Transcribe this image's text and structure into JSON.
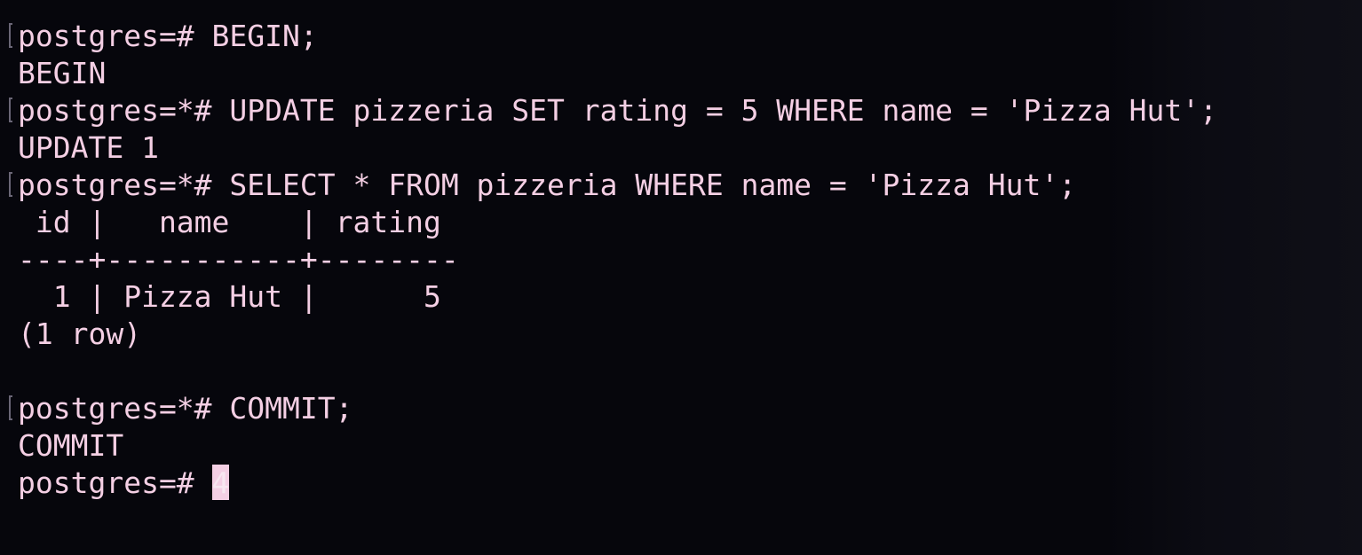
{
  "terminal": {
    "lines": [
      "postgres=# BEGIN;",
      "BEGIN",
      "postgres=*# UPDATE pizzeria SET rating = 5 WHERE name = 'Pizza Hut';",
      "UPDATE 1",
      "postgres=*# SELECT * FROM pizzeria WHERE name = 'Pizza Hut';",
      " id |   name    | rating",
      "----+-----------+--------",
      "  1 | Pizza Hut |      5",
      "(1 row)",
      "",
      "postgres=*# COMMIT;",
      "COMMIT"
    ],
    "prompt": "postgres=# ",
    "cursor_char": "4"
  },
  "colors": {
    "background": "#06060c",
    "text": "#f4cfe4",
    "cursor": "#f4cfe4"
  }
}
